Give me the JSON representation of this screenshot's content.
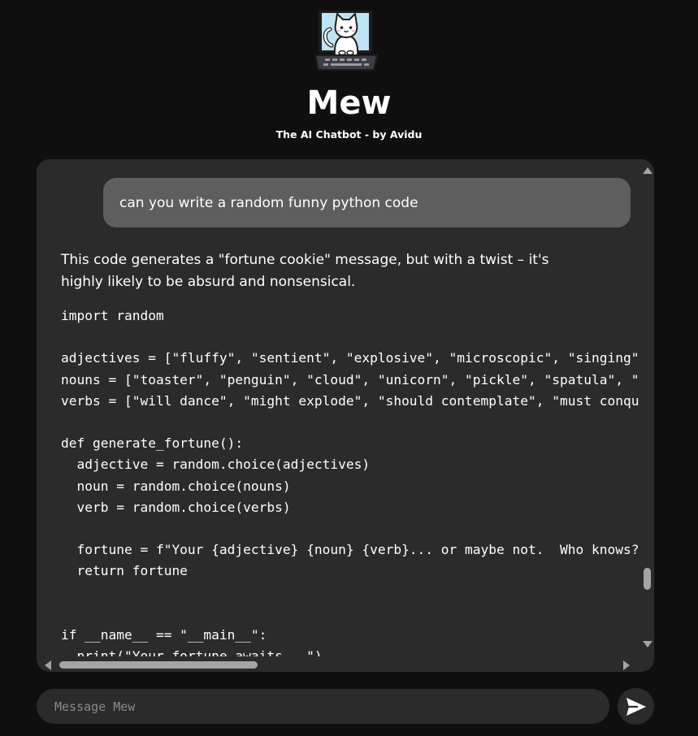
{
  "header": {
    "logo_icon": "cat-on-laptop-logo",
    "title": "Mew",
    "subtitle": "The AI Chatbot - by Avidu"
  },
  "chat": {
    "user_message": "can you write a random funny python code",
    "bot_intro": "This code generates a \"fortune cookie\" message, but with a twist – it's highly likely to be absurd and nonsensical.",
    "code_lines": [
      "import random",
      "",
      "adjectives = [\"fluffy\", \"sentient\", \"explosive\", \"microscopic\", \"singing\",",
      "nouns = [\"toaster\", \"penguin\", \"cloud\", \"unicorn\", \"pickle\", \"spatula\", \"a",
      "verbs = [\"will dance\", \"might explode\", \"should contemplate\", \"must conque",
      "",
      "def generate_fortune():",
      "  adjective = random.choice(adjectives)",
      "  noun = random.choice(nouns)",
      "  verb = random.choice(verbs)",
      "",
      "  fortune = f\"Your {adjective} {noun} {verb}... or maybe not.  Who knows?\"",
      "  return fortune",
      "",
      "",
      "if __name__ == \"__main__\":",
      "  print(\"Your fortune awaits...\")"
    ]
  },
  "composer": {
    "placeholder": "Message Mew",
    "value": "",
    "send_icon": "send-icon"
  },
  "colors": {
    "page_bg": "#0f0f0f",
    "panel_bg": "#2b2b2b",
    "user_bubble_bg": "#5e5e5e",
    "scrollbar": "#a5a5a5",
    "text": "#ffffff",
    "placeholder": "#8a8a8a"
  }
}
